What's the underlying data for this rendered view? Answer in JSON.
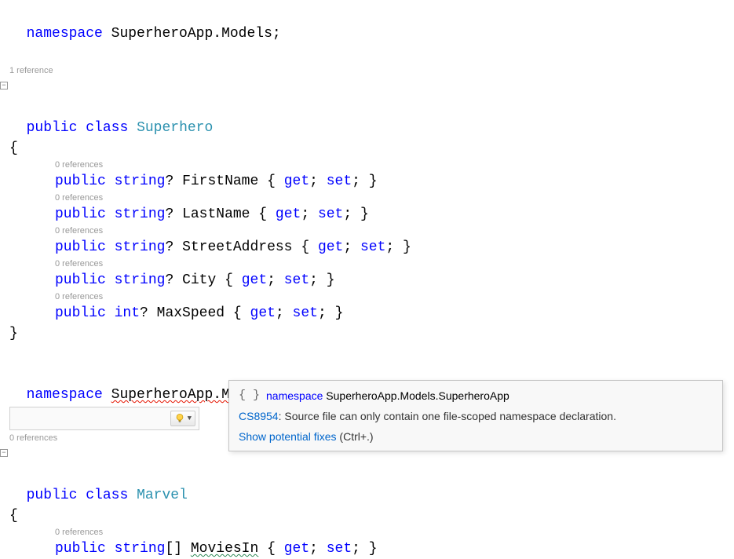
{
  "line_ns1": {
    "kw": "namespace",
    "name": "SuperheroApp.Models",
    "semi": ";"
  },
  "refs": {
    "one": "1 reference",
    "zero": "0 references"
  },
  "class1": {
    "public": "public",
    "class": "class",
    "name": "Superhero",
    "open": "{",
    "close": "}"
  },
  "prop_template": {
    "public": "public",
    "get": "get",
    "set": "set",
    "semi": ";",
    "open": "{",
    "close": "}",
    "q": "?"
  },
  "props": [
    {
      "type": "string",
      "name": "FirstName"
    },
    {
      "type": "string",
      "name": "LastName"
    },
    {
      "type": "string",
      "name": "StreetAddress"
    },
    {
      "type": "string",
      "name": "City"
    },
    {
      "type": "int",
      "name": "MaxSpeed"
    }
  ],
  "line_ns2": {
    "kw": "namespace",
    "name": "SuperheroApp.Models.Marvel",
    "semi": ";"
  },
  "class2": {
    "public": "public",
    "class": "class",
    "name": "Marvel",
    "open": "{"
  },
  "prop2": {
    "public": "public",
    "type": "string",
    "brackets": "[]",
    "name": "MoviesIn",
    "open": "{",
    "get": "get",
    "set": "set",
    "close": "}",
    "semi": ";"
  },
  "tooltip": {
    "brace": "{ }",
    "ns_kw": "namespace",
    "ns_text": "SuperheroApp.Models.SuperheroApp",
    "error_code": "CS8954",
    "error_sep": ": ",
    "error_msg": "Source file can only contain one file-scoped namespace declaration.",
    "fixes": "Show potential fixes",
    "shortcut": " (Ctrl+.)"
  }
}
